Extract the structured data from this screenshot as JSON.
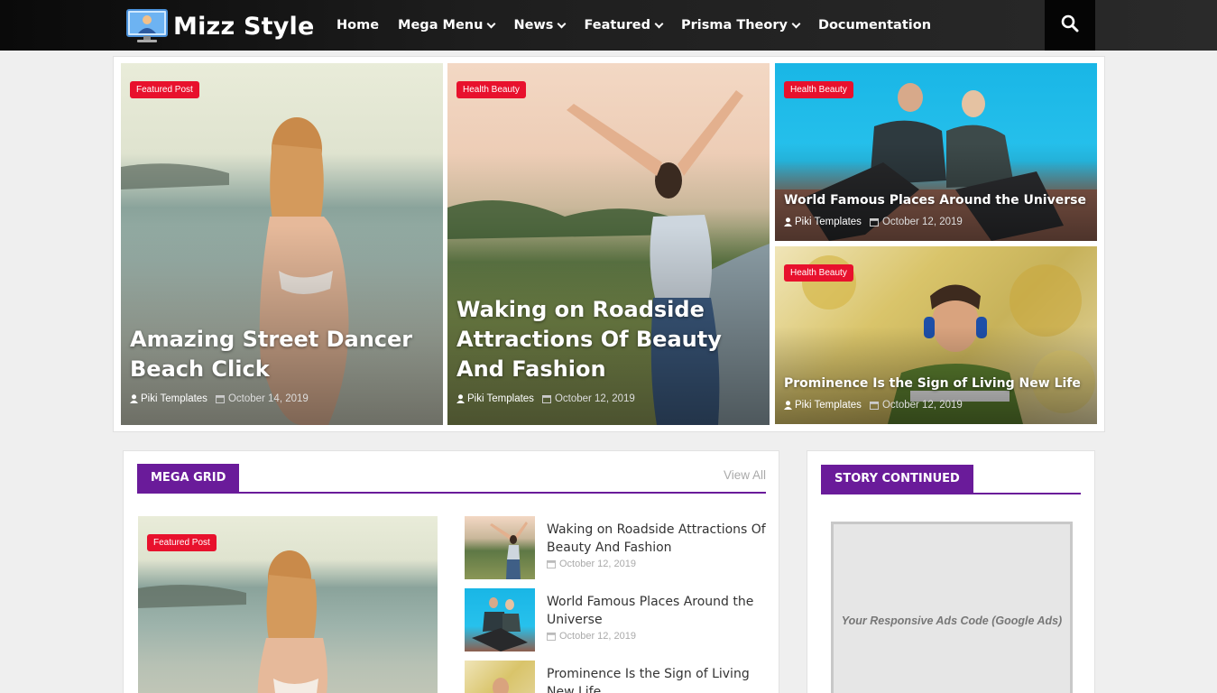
{
  "header": {
    "logo_text": "Mizz Style",
    "nav": [
      {
        "label": "Home",
        "dropdown": false
      },
      {
        "label": "Mega Menu",
        "dropdown": true
      },
      {
        "label": "News",
        "dropdown": true
      },
      {
        "label": "Featured",
        "dropdown": true
      },
      {
        "label": "Prisma Theory",
        "dropdown": true
      },
      {
        "label": "Documentation",
        "dropdown": false
      }
    ],
    "search_icon": "search-icon"
  },
  "featured": [
    {
      "badge": "Featured Post",
      "title": "Amazing Street Dancer Beach Click",
      "author": "Piki Templates",
      "date": "October 14, 2019"
    },
    {
      "badge": "Health Beauty",
      "title": "Waking on Roadside Attractions Of Beauty And Fashion",
      "author": "Piki Templates",
      "date": "October 12, 2019"
    },
    {
      "badge": "Health Beauty",
      "title": "World Famous Places Around the Universe",
      "author": "Piki Templates",
      "date": "October 12, 2019"
    },
    {
      "badge": "Health Beauty",
      "title": "Prominence Is the Sign of Living New Life",
      "author": "Piki Templates",
      "date": "October 12, 2019"
    }
  ],
  "mega_grid": {
    "label": "MEGA GRID",
    "view_all": "View All",
    "feature_badge": "Featured Post",
    "posts": [
      {
        "title": "Waking on Roadside Attractions Of Beauty And Fashion",
        "date": "October 12, 2019"
      },
      {
        "title": "World Famous Places Around the Universe",
        "date": "October 12, 2019"
      },
      {
        "title": "Prominence Is the Sign of Living New Life",
        "date": ""
      }
    ]
  },
  "story": {
    "label": "STORY CONTINUED",
    "ad_text": "Your Responsive Ads Code (Google Ads)"
  },
  "colors": {
    "accent_purple": "#6a1b9a",
    "badge_red": "#e8112d",
    "header_dark": "#1e1e1e"
  }
}
